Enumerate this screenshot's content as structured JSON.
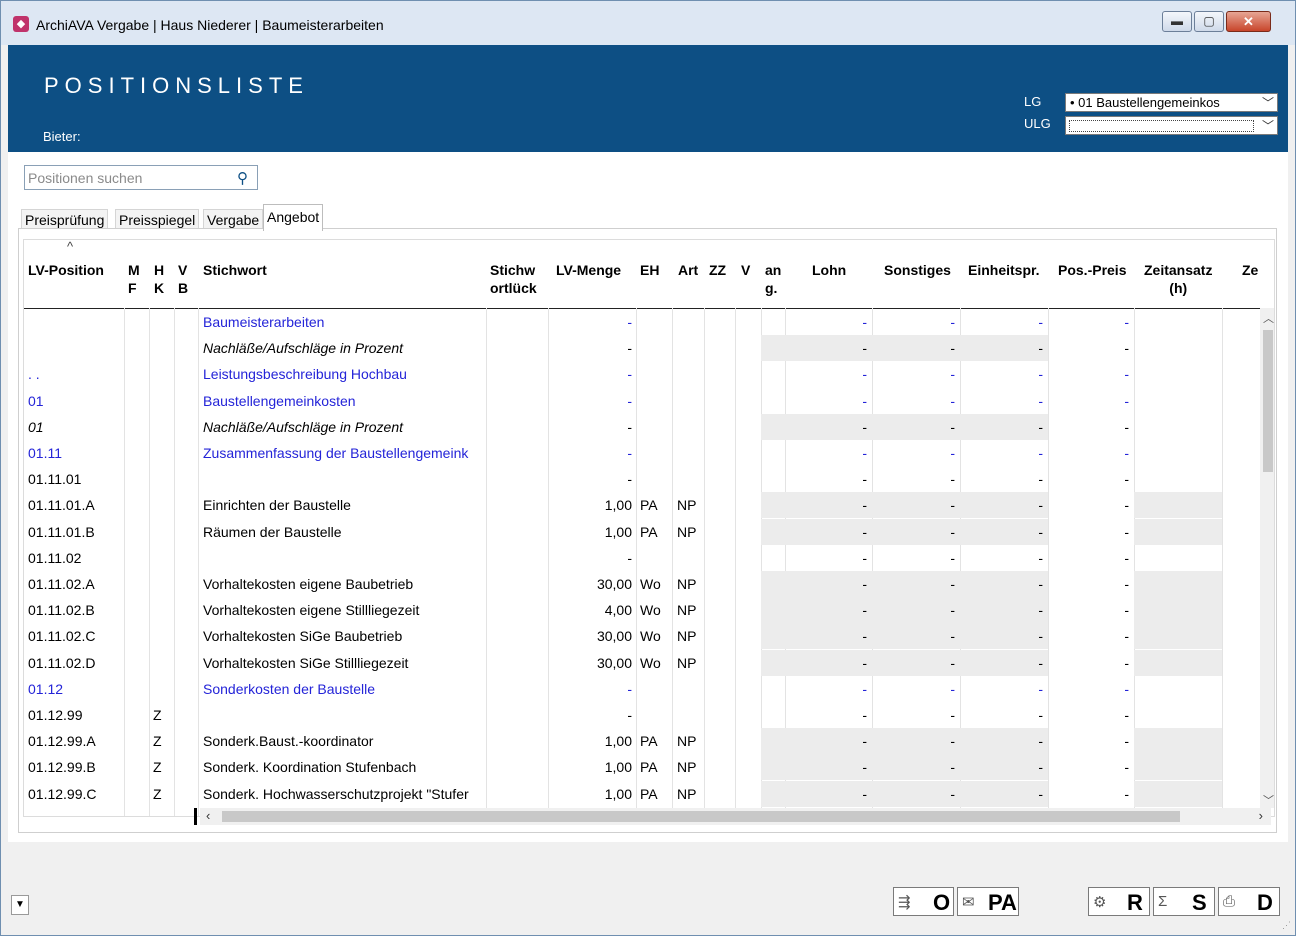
{
  "window": {
    "title": "ArchiAVA Vergabe | Haus Niederer | Baumeisterarbeiten",
    "min_glyph": "▬",
    "max_glyph": "▢",
    "close_glyph": "✕"
  },
  "header": {
    "page_title": "POSITIONSLISTE",
    "bieter_label": "Bieter:",
    "lg_label": "LG",
    "ulg_label": "ULG",
    "lg_value": "• 01 Baustellengemeinkos",
    "ulg_value": ""
  },
  "search": {
    "placeholder": "Positionen suchen",
    "icon": "search-icon"
  },
  "tabs": [
    {
      "label": "Preisprüfung"
    },
    {
      "label": "Preisspiegel"
    },
    {
      "label": "Vergabe"
    },
    {
      "label": "Angebot",
      "active": true
    }
  ],
  "columns": {
    "lvpos": "LV-Position",
    "mf": "M\nF",
    "hk": "H\nK",
    "vb": "V\nB",
    "stichwort": "Stichwort",
    "stichwortlueck": "Stichw\nortlück",
    "menge": "LV-Menge",
    "eh": "EH",
    "art": "Art",
    "zz": "ZZ",
    "v": "V",
    "ang": "an\ng.",
    "lohn": "Lohn",
    "sonstiges": "Sonstiges",
    "ep": "Einheitspr.",
    "pp": "Pos.-Preis",
    "zeit": "Zeitansatz\n(h)",
    "ze": "Ze",
    "sort_glyph": "^"
  },
  "rows": [
    {
      "pos": "",
      "hk": "",
      "stichwort": "Baumeisterarbeiten",
      "menge": "-",
      "eh": "",
      "art": "",
      "lohn": "-",
      "sonst": "-",
      "ep": "-",
      "pp": "-",
      "style": "blue"
    },
    {
      "pos": "",
      "hk": "",
      "stichwort": "Nachläße/Aufschläge in Prozent",
      "menge": "-",
      "eh": "",
      "art": "",
      "lohn": "-",
      "sonst": "-",
      "ep": "-",
      "pp": "-",
      "style": "italic"
    },
    {
      "pos": ". .",
      "hk": "",
      "stichwort": "Leistungsbeschreibung Hochbau",
      "menge": "-",
      "eh": "",
      "art": "",
      "lohn": "-",
      "sonst": "-",
      "ep": "-",
      "pp": "-",
      "style": "blue"
    },
    {
      "pos": "01",
      "hk": "",
      "stichwort": "Baustellengemeinkosten",
      "menge": "-",
      "eh": "",
      "art": "",
      "lohn": "-",
      "sonst": "-",
      "ep": "-",
      "pp": "-",
      "style": "blue"
    },
    {
      "pos": "01",
      "hk": "",
      "stichwort": "Nachläße/Aufschläge in Prozent",
      "menge": "-",
      "eh": "",
      "art": "",
      "lohn": "-",
      "sonst": "-",
      "ep": "-",
      "pp": "-",
      "style": "italic"
    },
    {
      "pos": "01.11",
      "hk": "",
      "stichwort": "Zusammenfassung der Baustellengemeink",
      "menge": "-",
      "eh": "",
      "art": "",
      "lohn": "-",
      "sonst": "-",
      "ep": "-",
      "pp": "-",
      "style": "blue"
    },
    {
      "pos": "01.11.01",
      "hk": "",
      "stichwort": "",
      "menge": "-",
      "eh": "",
      "art": "",
      "lohn": "-",
      "sonst": "-",
      "ep": "-",
      "pp": "-",
      "style": "normal"
    },
    {
      "pos": "01.11.01.A",
      "hk": "",
      "stichwort": "Einrichten der Baustelle",
      "menge": "1,00",
      "eh": "PA",
      "art": "NP",
      "lohn": "-",
      "sonst": "-",
      "ep": "-",
      "pp": "-",
      "style": "item"
    },
    {
      "pos": "01.11.01.B",
      "hk": "",
      "stichwort": "Räumen der Baustelle",
      "menge": "1,00",
      "eh": "PA",
      "art": "NP",
      "lohn": "-",
      "sonst": "-",
      "ep": "-",
      "pp": "-",
      "style": "item"
    },
    {
      "pos": "01.11.02",
      "hk": "",
      "stichwort": "",
      "menge": "-",
      "eh": "",
      "art": "",
      "lohn": "-",
      "sonst": "-",
      "ep": "-",
      "pp": "-",
      "style": "normal"
    },
    {
      "pos": "01.11.02.A",
      "hk": "",
      "stichwort": "Vorhaltekosten eigene Baubetrieb",
      "menge": "30,00",
      "eh": "Wo",
      "art": "NP",
      "lohn": "-",
      "sonst": "-",
      "ep": "-",
      "pp": "-",
      "style": "item"
    },
    {
      "pos": "01.11.02.B",
      "hk": "",
      "stichwort": "Vorhaltekosten eigene Stillliegezeit",
      "menge": "4,00",
      "eh": "Wo",
      "art": "NP",
      "lohn": "-",
      "sonst": "-",
      "ep": "-",
      "pp": "-",
      "style": "item"
    },
    {
      "pos": "01.11.02.C",
      "hk": "",
      "stichwort": "Vorhaltekosten SiGe Baubetrieb",
      "menge": "30,00",
      "eh": "Wo",
      "art": "NP",
      "lohn": "-",
      "sonst": "-",
      "ep": "-",
      "pp": "-",
      "style": "item"
    },
    {
      "pos": "01.11.02.D",
      "hk": "",
      "stichwort": "Vorhaltekosten SiGe Stillliegezeit",
      "menge": "30,00",
      "eh": "Wo",
      "art": "NP",
      "lohn": "-",
      "sonst": "-",
      "ep": "-",
      "pp": "-",
      "style": "item"
    },
    {
      "pos": "01.12",
      "hk": "",
      "stichwort": "Sonderkosten der Baustelle",
      "menge": "-",
      "eh": "",
      "art": "",
      "lohn": "-",
      "sonst": "-",
      "ep": "-",
      "pp": "-",
      "style": "blue"
    },
    {
      "pos": "01.12.99",
      "hk": "Z",
      "stichwort": "",
      "menge": "-",
      "eh": "",
      "art": "",
      "lohn": "-",
      "sonst": "-",
      "ep": "-",
      "pp": "-",
      "style": "normal"
    },
    {
      "pos": "01.12.99.A",
      "hk": "Z",
      "stichwort": "Sonderk.Baust.-koordinator",
      "menge": "1,00",
      "eh": "PA",
      "art": "NP",
      "lohn": "-",
      "sonst": "-",
      "ep": "-",
      "pp": "-",
      "style": "item"
    },
    {
      "pos": "01.12.99.B",
      "hk": "Z",
      "stichwort": "Sonderk. Koordination Stufenbach",
      "menge": "1,00",
      "eh": "PA",
      "art": "NP",
      "lohn": "-",
      "sonst": "-",
      "ep": "-",
      "pp": "-",
      "style": "item"
    },
    {
      "pos": "01.12.99.C",
      "hk": "Z",
      "stichwort": "Sonderk. Hochwasserschutzprojekt \"Stufer",
      "menge": "1,00",
      "eh": "PA",
      "art": "NP",
      "lohn": "-",
      "sonst": "-",
      "ep": "-",
      "pp": "-",
      "style": "item"
    }
  ],
  "toolbar": {
    "dropdown_glyph": "▼",
    "o_label": "O",
    "o_icon": "⇶",
    "pa_label": "PA",
    "pa_icon": "✉",
    "r_label": "R",
    "r_icon": "⚙",
    "s_label": "S",
    "s_icon": "Σ",
    "d_label": "D",
    "d_icon": "⎙"
  },
  "colors": {
    "header_bg": "#0d4f84",
    "link_blue": "#2424d8",
    "shade": "#ececec"
  }
}
